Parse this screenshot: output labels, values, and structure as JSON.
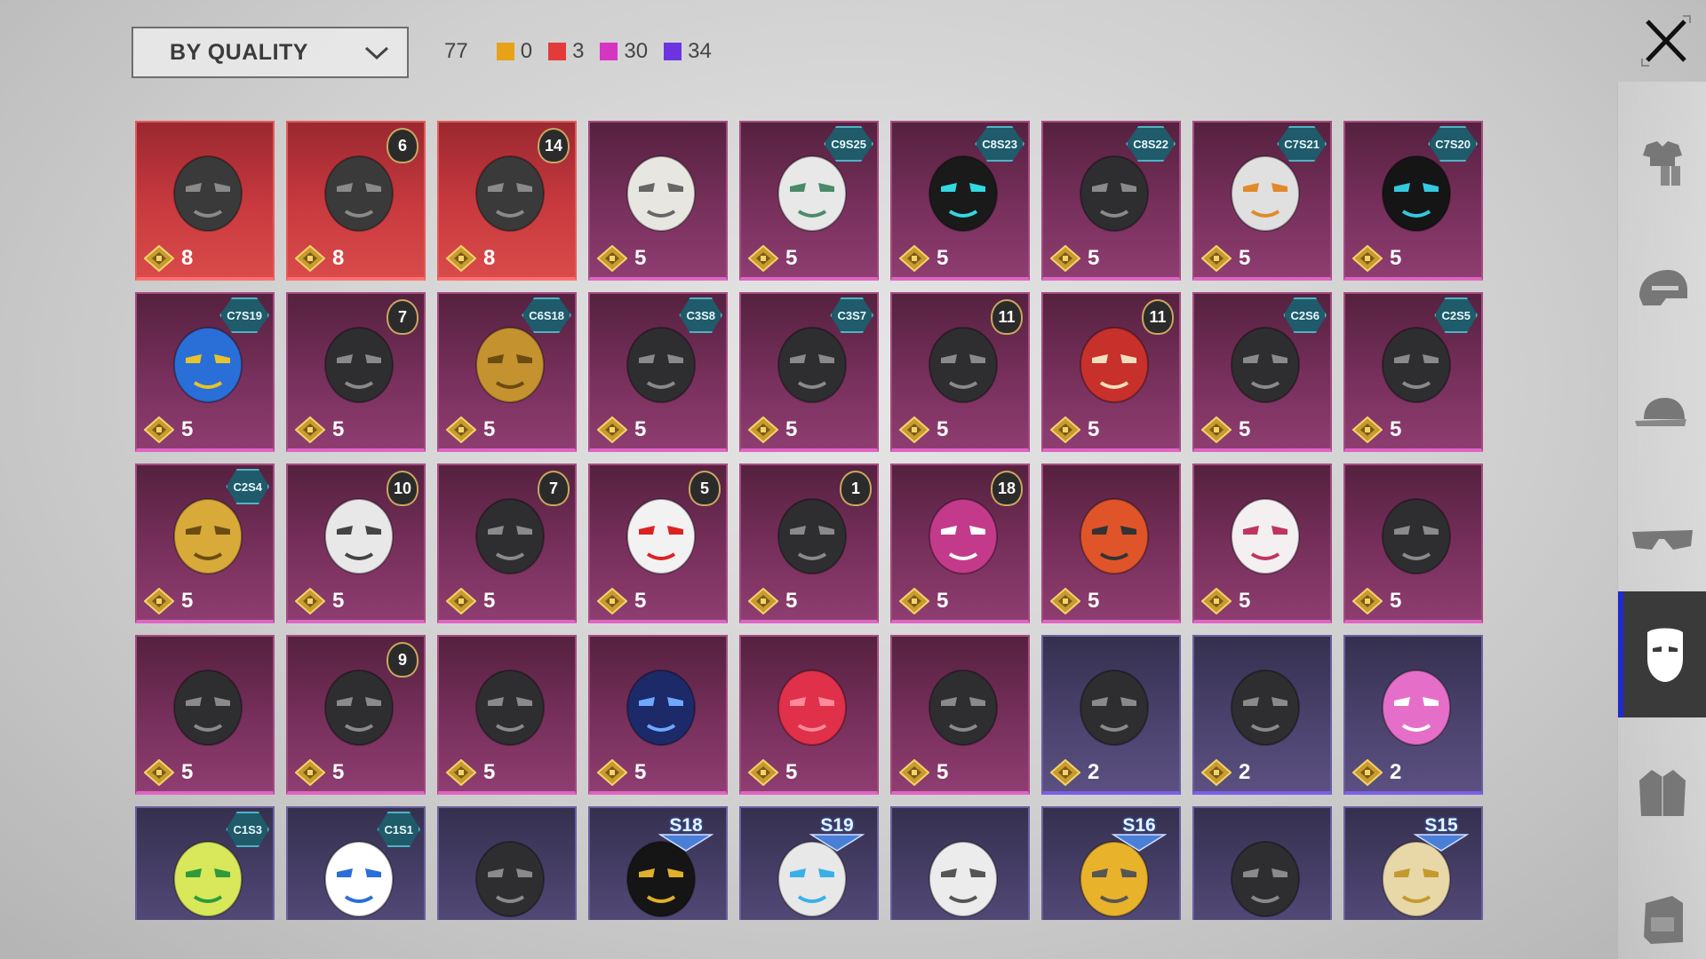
{
  "filter": {
    "sort_label": "BY QUALITY",
    "total": "77",
    "counts": [
      {
        "color": "#e8a21a",
        "value": "0"
      },
      {
        "color": "#e43a3a",
        "value": "3"
      },
      {
        "color": "#d635c2",
        "value": "30"
      },
      {
        "color": "#6c34e0",
        "value": "34"
      }
    ]
  },
  "sidebar": {
    "tabs": [
      {
        "icon": "outfit-icon"
      },
      {
        "icon": "helmet-icon"
      },
      {
        "icon": "cap-icon"
      },
      {
        "icon": "glasses-icon"
      },
      {
        "icon": "mask-icon",
        "active": true
      },
      {
        "icon": "jacket-icon"
      },
      {
        "icon": "backpack-icon"
      }
    ]
  },
  "items": [
    {
      "quality": "red",
      "value": "8",
      "art": "mask-dark-goggles"
    },
    {
      "quality": "red",
      "value": "8",
      "badge": {
        "kind": "round",
        "text": "6"
      },
      "art": "mask-plague-beak"
    },
    {
      "quality": "red",
      "value": "8",
      "badge": {
        "kind": "round",
        "text": "14"
      },
      "art": "mask-bronze-jaw"
    },
    {
      "quality": "pink",
      "value": "5",
      "art": "mask-cat-face"
    },
    {
      "quality": "pink",
      "value": "5",
      "badge": {
        "kind": "hex",
        "text": "C9S25"
      },
      "art": "mask-green-tech"
    },
    {
      "quality": "pink",
      "value": "5",
      "badge": {
        "kind": "hex",
        "text": "C8S23"
      },
      "art": "mask-cyan-neon"
    },
    {
      "quality": "pink",
      "value": "5",
      "badge": {
        "kind": "hex",
        "text": "C8S22"
      },
      "art": "mask-black-ring"
    },
    {
      "quality": "pink",
      "value": "5",
      "badge": {
        "kind": "hex",
        "text": "C7S21"
      },
      "art": "mask-white-armor"
    },
    {
      "quality": "pink",
      "value": "5",
      "badge": {
        "kind": "hex",
        "text": "C7S20"
      },
      "art": "mask-black-cyan"
    },
    {
      "quality": "pink",
      "value": "5",
      "badge": {
        "kind": "hex",
        "text": "C7S19"
      },
      "art": "mask-colorful"
    },
    {
      "quality": "pink",
      "value": "5",
      "badge": {
        "kind": "round",
        "text": "7"
      },
      "art": "mask-wire"
    },
    {
      "quality": "pink",
      "value": "5",
      "badge": {
        "kind": "hex",
        "text": "C6S18"
      },
      "art": "mask-gold-horns"
    },
    {
      "quality": "pink",
      "value": "5",
      "badge": {
        "kind": "hex",
        "text": "C3S8"
      },
      "art": "mask-respirator"
    },
    {
      "quality": "pink",
      "value": "5",
      "badge": {
        "kind": "hex",
        "text": "C3S7"
      },
      "art": "mask-gold-purple"
    },
    {
      "quality": "pink",
      "value": "5",
      "badge": {
        "kind": "round",
        "text": "11"
      },
      "art": "mask-white-gold"
    },
    {
      "quality": "pink",
      "value": "5",
      "badge": {
        "kind": "round",
        "text": "11"
      },
      "art": "mask-red-oni"
    },
    {
      "quality": "pink",
      "value": "5",
      "badge": {
        "kind": "hex",
        "text": "C2S6"
      },
      "art": "mask-dark-pattern"
    },
    {
      "quality": "pink",
      "value": "5",
      "badge": {
        "kind": "hex",
        "text": "C2S5"
      },
      "art": "mask-tribal"
    },
    {
      "quality": "pink",
      "value": "5",
      "badge": {
        "kind": "hex",
        "text": "C2S4"
      },
      "art": "mask-gold-robot"
    },
    {
      "quality": "pink",
      "value": "5",
      "badge": {
        "kind": "round",
        "text": "10"
      },
      "art": "mask-white-gas"
    },
    {
      "quality": "pink",
      "value": "5",
      "badge": {
        "kind": "round",
        "text": "7"
      },
      "art": "mask-gold-violet"
    },
    {
      "quality": "pink",
      "value": "5",
      "badge": {
        "kind": "round",
        "text": "5"
      },
      "art": "mask-clown"
    },
    {
      "quality": "pink",
      "value": "5",
      "badge": {
        "kind": "round",
        "text": "1"
      },
      "art": "mask-knight"
    },
    {
      "quality": "pink",
      "value": "5",
      "badge": {
        "kind": "round",
        "text": "18"
      },
      "art": "mask-football"
    },
    {
      "quality": "pink",
      "value": "5",
      "art": "mask-orange-skull"
    },
    {
      "quality": "pink",
      "value": "5",
      "art": "mask-kitsune"
    },
    {
      "quality": "pink",
      "value": "5",
      "art": "mask-black-cat"
    },
    {
      "quality": "pink",
      "value": "5",
      "art": "mask-headset"
    },
    {
      "quality": "pink",
      "value": "5",
      "badge": {
        "kind": "round",
        "text": "9"
      },
      "art": "mask-steel-helm"
    },
    {
      "quality": "pink",
      "value": "5",
      "art": "mask-leather-beak"
    },
    {
      "quality": "pink",
      "value": "5",
      "art": "mask-galaxy"
    },
    {
      "quality": "pink",
      "value": "5",
      "art": "mask-red-nose"
    },
    {
      "quality": "pink",
      "value": "5",
      "art": "mask-skull-bandana"
    },
    {
      "quality": "purple",
      "value": "2",
      "art": "mask-gray-cloth"
    },
    {
      "quality": "purple",
      "value": "2",
      "art": "mask-red-eye"
    },
    {
      "quality": "purple",
      "value": "2",
      "art": "mask-pink-dino"
    },
    {
      "quality": "purple",
      "badge": {
        "kind": "hex",
        "text": "C1S3"
      },
      "art": "mask-cactus"
    },
    {
      "quality": "purple",
      "badge": {
        "kind": "hex",
        "text": "C1S1"
      },
      "art": "mask-blue-white"
    },
    {
      "quality": "purple",
      "art": "mask-steel-half"
    },
    {
      "quality": "purple",
      "badge": {
        "kind": "season",
        "text": "S18"
      },
      "art": "mask-pulse"
    },
    {
      "quality": "purple",
      "badge": {
        "kind": "season",
        "text": "S19"
      },
      "art": "mask-visor"
    },
    {
      "quality": "purple",
      "art": "mask-white-bird"
    },
    {
      "quality": "purple",
      "badge": {
        "kind": "season",
        "text": "S16"
      },
      "art": "mask-yellow-spike"
    },
    {
      "quality": "purple",
      "art": "mask-bandana"
    },
    {
      "quality": "purple",
      "badge": {
        "kind": "season",
        "text": "S15"
      },
      "art": "mask-gold-skull"
    }
  ]
}
